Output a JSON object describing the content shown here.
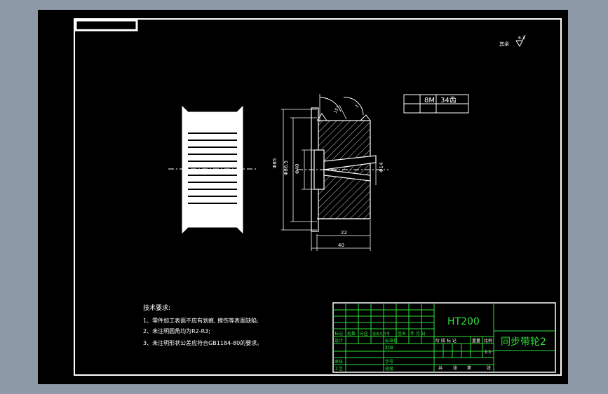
{
  "drawing": {
    "title": "同步带轮2",
    "material": "HT200",
    "roughness_note": "其余",
    "roughness_value": "6.3",
    "tooth_spec": {
      "pitch": "8M",
      "teeth": "34齿"
    },
    "dimensions": {
      "outer_dia": "Φ85",
      "pitch_dia": "Φ86.5",
      "bore_dia": "Φ40",
      "keyway": "Φ14",
      "hub_width": "22",
      "total_width": "40",
      "angle": "15°",
      "chamfer": "1"
    },
    "tech_requirements": {
      "heading": "技术要求:",
      "items": [
        "1、零件加工表面不应有划痕, 擦伤等表面缺陷;",
        "2、未注明圆角均为R2-R3;",
        "3、未注明形状公差应符合GB1184-80的要求。"
      ]
    },
    "title_block": {
      "header_labels": [
        "标记",
        "处数",
        "分区",
        "更改文件号",
        "签名",
        "年 月 日"
      ],
      "role_labels": [
        "设计",
        "审核",
        "工艺"
      ],
      "middle_labels": [
        "标准化",
        "批准",
        "学号",
        "班级"
      ],
      "stage_labels": [
        "阶 段 标 记",
        "重量",
        "比例"
      ],
      "scale": "1:1",
      "sheet_info": [
        "共",
        "张",
        "第",
        "张"
      ]
    }
  }
}
